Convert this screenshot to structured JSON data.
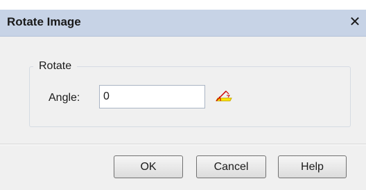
{
  "window": {
    "title": "Rotate Image",
    "close_symbol": "✕"
  },
  "rotate_group": {
    "legend": "Rotate",
    "angle_label": "Angle:",
    "angle_value": "0",
    "angle_tool_icon": "angle-measure-icon"
  },
  "buttons": {
    "ok": "OK",
    "cancel": "Cancel",
    "help": "Help"
  },
  "colors": {
    "titlebar": "#c7d3e6",
    "dialog_background": "#f0f0f0",
    "icon_yellow": "#ffe800",
    "icon_red": "#cc0000"
  }
}
